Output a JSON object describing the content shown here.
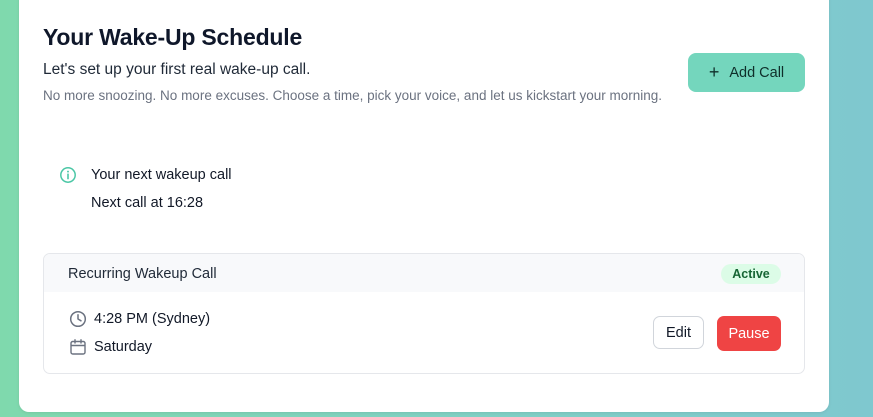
{
  "page": {
    "title": "Your Wake-Up Schedule",
    "subtitle": "Let's set up your first real wake-up call.",
    "description": "No more snoozing. No more excuses. Choose a time, pick your voice, and let us kickstart your morning."
  },
  "actions": {
    "add_call_label": "Add Call",
    "add_call_icon": "plus-icon"
  },
  "next_call": {
    "icon": "info-icon",
    "title": "Your next wakeup call",
    "detail": "Next call at 16:28"
  },
  "schedules": [
    {
      "name": "Recurring Wakeup Call",
      "status": "Active",
      "time": "4:28 PM (Sydney)",
      "time_icon": "clock-icon",
      "day": "Saturday",
      "day_icon": "calendar-icon",
      "edit_label": "Edit",
      "pause_label": "Pause"
    }
  ],
  "colors": {
    "accent": "#74d6bd",
    "info_icon": "#4cc7a6",
    "badge_bg": "#dcfce7",
    "badge_text": "#166534",
    "danger": "#ef4444"
  }
}
